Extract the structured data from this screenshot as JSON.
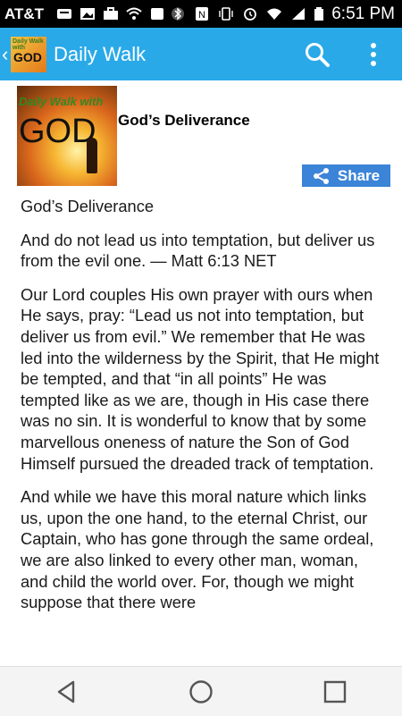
{
  "status_bar": {
    "carrier": "AT&T",
    "time": "6:51 PM"
  },
  "app_bar": {
    "title": "Daily Walk",
    "logo_text_top": "Daily Walk with",
    "logo_text_main": "GOD"
  },
  "entry": {
    "thumbnail_text_top": "Daily Walk with",
    "thumbnail_text_main": "GOD",
    "title": "God’s Deliverance",
    "share_label": "Share"
  },
  "article": {
    "heading": "God’s Deliverance",
    "paragraphs": [
      "And do not lead us into temptation, but deliver us from the evil one. — Matt 6:13 NET",
      "Our Lord couples His own prayer with ours when He says, pray: “Lead us not into temptation, but deliver us from evil.” We remember that He was led into the wilderness by the Spirit, that He might be tempted, and that “in all points” He was tempted like as we are, though in His case there was no sin. It is wonderful to know that by some marvellous oneness of nature the Son of God Himself pursued the dreaded track of temptation.",
      "And while we have this moral nature which links us, upon the one hand, to the eternal Christ, our Captain, who has gone through the same ordeal, we are also linked to every other man, woman, and child the world over. For, though we might suppose that there were"
    ]
  },
  "colors": {
    "app_bar": "#2aa9e8",
    "share_button": "#3b84d8"
  }
}
